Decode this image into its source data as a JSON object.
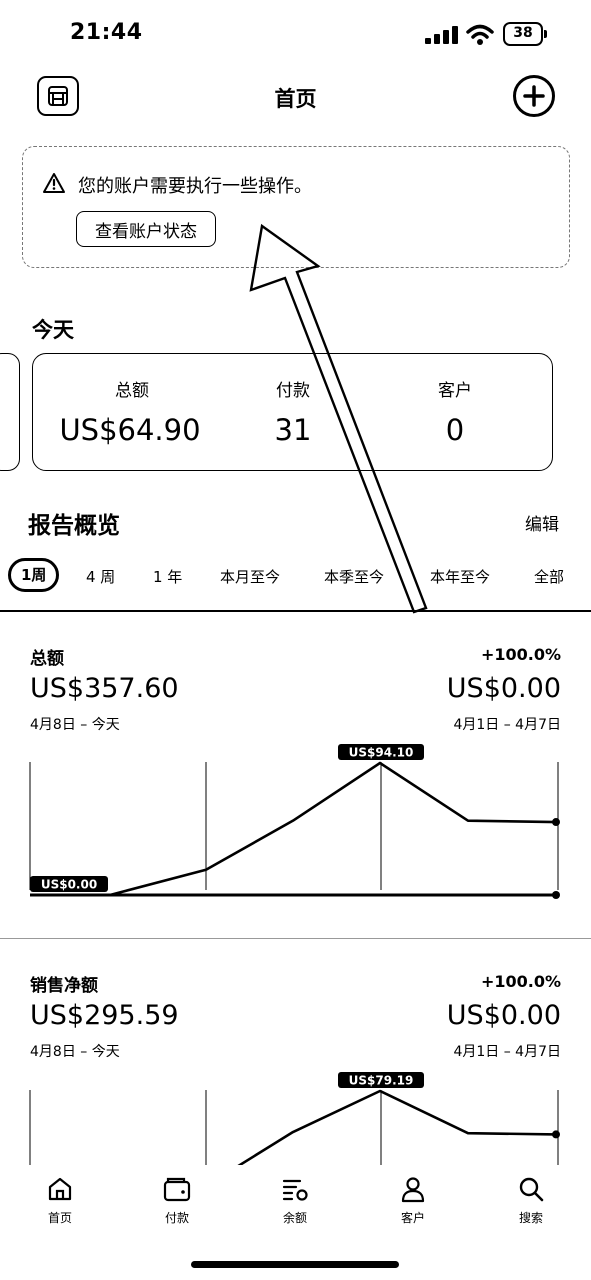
{
  "status_bar": {
    "time": "21:44",
    "battery": "38"
  },
  "header": {
    "title": "首页"
  },
  "alert": {
    "message": "您的账户需要执行一些操作。",
    "button": "查看账户状态"
  },
  "today": {
    "title": "今天",
    "stats": [
      {
        "label": "总额",
        "value": "US$64.90"
      },
      {
        "label": "付款",
        "value": "31"
      },
      {
        "label": "客户",
        "value": "0"
      }
    ]
  },
  "report": {
    "title": "报告概览",
    "edit": "编辑",
    "tabs": [
      "1周",
      "4 周",
      "1 年",
      "本月至今",
      "本季至今",
      "本年至今",
      "全部"
    ],
    "selected_tab": "1周"
  },
  "sections": [
    {
      "title": "总额",
      "change": "+100.0%",
      "current": "US$357.60",
      "previous": "US$0.00",
      "current_range": "4月8日 – 今天",
      "previous_range": "4月1日 – 4月7日",
      "label_max": "US$94.10",
      "label_min": "US$0.00"
    },
    {
      "title": "销售净额",
      "change": "+100.0%",
      "current": "US$295.59",
      "previous": "US$0.00",
      "current_range": "4月8日 – 今天",
      "previous_range": "4月1日 – 4月7日",
      "label_max": "US$79.19"
    }
  ],
  "nav": [
    {
      "label": "首页",
      "icon": "home-icon"
    },
    {
      "label": "付款",
      "icon": "wallet-icon"
    },
    {
      "label": "余额",
      "icon": "balance-icon"
    },
    {
      "label": "客户",
      "icon": "person-icon"
    },
    {
      "label": "搜索",
      "icon": "search-icon"
    }
  ],
  "chart_data": [
    {
      "type": "line",
      "series": [
        {
          "values": [
            0.0,
            0.0,
            18.0,
            53.0,
            94.1,
            53.0,
            52.0
          ]
        },
        {
          "values": [
            0.0,
            0.0,
            0.0,
            0.0,
            0.0,
            0.0,
            0.0
          ]
        }
      ],
      "annotations": [
        "US$94.10",
        "US$0.00"
      ]
    },
    {
      "type": "line",
      "series": [
        {
          "values": [
            0.0,
            0.0,
            0.0,
            45.0,
            79.19,
            44.0,
            43.0
          ]
        }
      ],
      "annotations": [
        "US$79.19"
      ]
    }
  ]
}
